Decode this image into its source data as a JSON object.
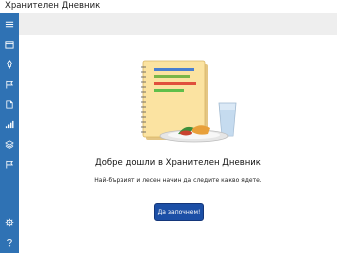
{
  "window": {
    "title": "Хранителен Дневник"
  },
  "sidebar": {
    "items": [
      {
        "icon": "hamburger-menu-icon"
      },
      {
        "icon": "calendar-icon"
      },
      {
        "icon": "pin-icon"
      },
      {
        "icon": "flag-icon"
      },
      {
        "icon": "document-icon"
      },
      {
        "icon": "bar-chart-icon"
      },
      {
        "icon": "layers-icon"
      },
      {
        "icon": "flag-icon"
      },
      {
        "icon": "gear-icon"
      },
      {
        "icon": "help-icon"
      }
    ]
  },
  "main": {
    "welcome_title": "Добре дошли в Хранителен Дневник",
    "subtitle": "Най-бързият и лесен начин да следите какво ядете.",
    "start_button_label": "Да започнем!"
  },
  "colors": {
    "sidebar": "#2f72b4",
    "accent": "#1c4fa6",
    "top_band": "#eeeeee"
  }
}
